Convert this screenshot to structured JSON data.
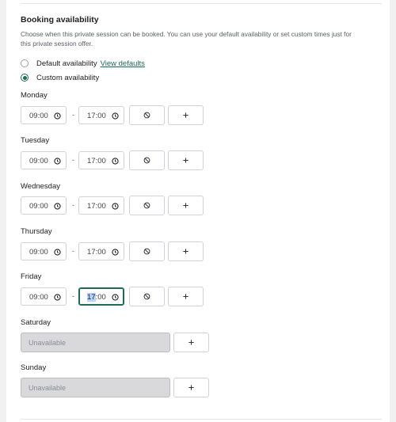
{
  "section": {
    "title": "Booking availability",
    "description": "Choose when this private session can be booked. You can use your default availability or set custom times just for this private session offer."
  },
  "options": {
    "default_label": "Default availability",
    "view_defaults_link": "View defaults",
    "custom_label": "Custom availability",
    "selected": "custom"
  },
  "days": [
    {
      "name": "Monday",
      "start": "09:00",
      "end": "17:00"
    },
    {
      "name": "Tuesday",
      "start": "09:00",
      "end": "17:00"
    },
    {
      "name": "Wednesday",
      "start": "09:00",
      "end": "17:00"
    },
    {
      "name": "Thursday",
      "start": "09:00",
      "end": "17:00"
    },
    {
      "name": "Friday",
      "start": "09:00",
      "end_hours": "17",
      "end_minutes": ":00"
    },
    {
      "name": "Saturday",
      "unavailable_text": "Unavailable"
    },
    {
      "name": "Sunday",
      "unavailable_text": "Unavailable"
    }
  ],
  "separator": "-",
  "icons": {
    "clock": "clock-icon",
    "block": "block-icon",
    "plus": "plus-icon"
  },
  "colors": {
    "accent": "#1e6a57",
    "selection": "#b6d4fb",
    "unavailable_bg": "#d9d9dc"
  }
}
